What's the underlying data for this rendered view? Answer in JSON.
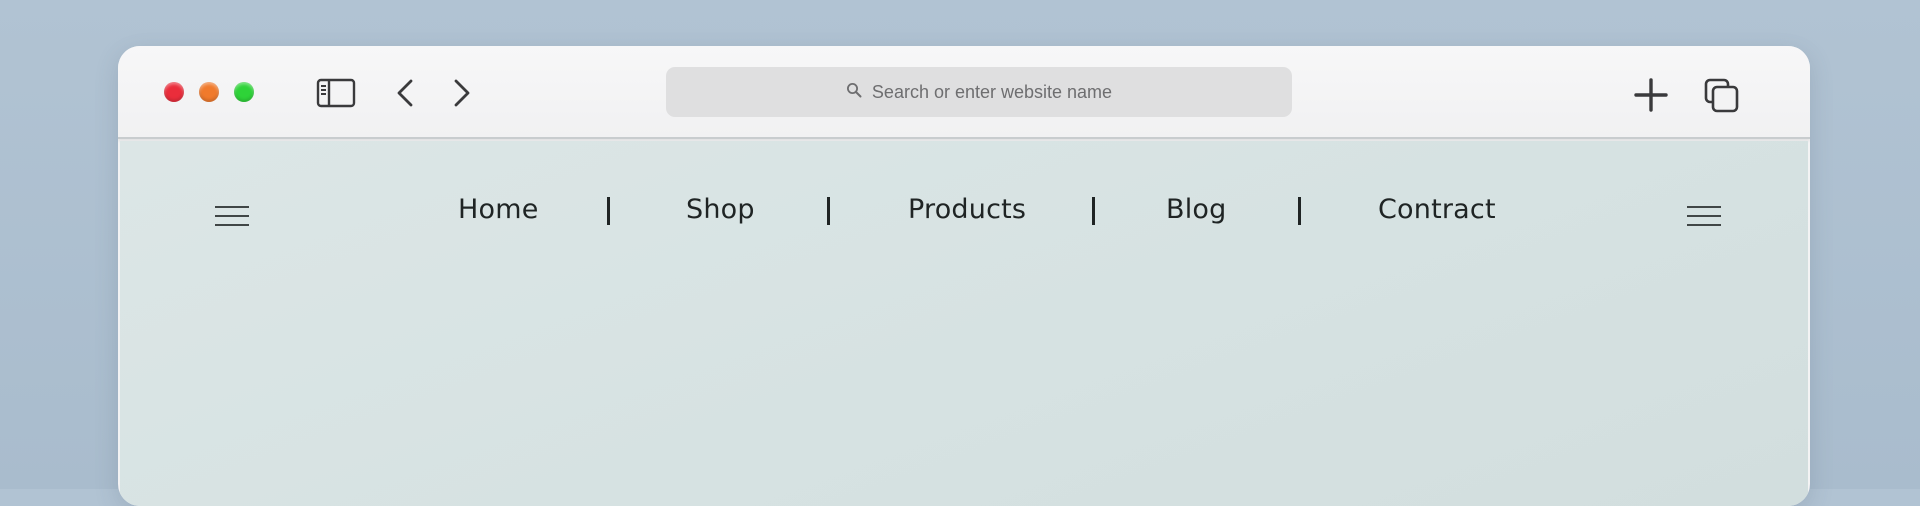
{
  "browser": {
    "window_controls": {
      "close_color": "#ea2d3b",
      "minimize_color": "#f07a2c",
      "maximize_color": "#2ed338"
    },
    "toolbar_icons": [
      "sidebar-icon",
      "chevron-left-icon",
      "chevron-right-icon",
      "plus-icon",
      "tabs-overview-icon"
    ],
    "address_bar": {
      "placeholder": "Search or enter website name",
      "icon": "search-icon"
    }
  },
  "site": {
    "nav": {
      "items": [
        {
          "label": "Home"
        },
        {
          "label": "Shop"
        },
        {
          "label": "Products"
        },
        {
          "label": "Blog"
        },
        {
          "label": "Contract"
        }
      ],
      "left_menu_icon": "hamburger-menu-icon",
      "right_menu_icon": "hamburger-menu-icon"
    }
  }
}
